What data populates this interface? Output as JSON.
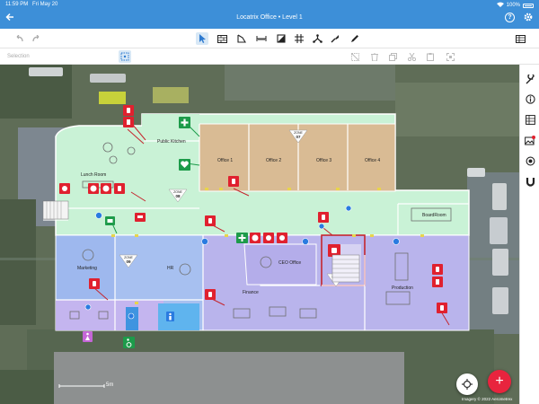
{
  "status_bar": {
    "time": "11:59 PM",
    "date": "Fri May 20",
    "battery": "100%"
  },
  "header": {
    "title": "Locatrix Office • Level 1",
    "back_icon": "back-arrow-icon",
    "help_label": "?",
    "settings_icon": "gear-icon"
  },
  "toolbar": {
    "undo_icon": "undo-icon",
    "redo_icon": "redo-icon",
    "tools": [
      "select-arrow-icon",
      "wall-icon",
      "room-icon",
      "dimension-icon",
      "door-icon",
      "grid-icon",
      "network-icon",
      "marker-icon",
      "pen-icon"
    ],
    "table_icon": "table-icon"
  },
  "subbar": {
    "label": "Selection",
    "actions": [
      "select-area-icon",
      "deselect-icon",
      "delete-icon",
      "copy-icon",
      "cut-icon",
      "paste-icon",
      "fit-icon"
    ]
  },
  "rooms": {
    "public_kitchen": "Public Kitchen",
    "office_1": "Office 1",
    "office_2": "Office 2",
    "office_3": "Office 3",
    "office_4": "Office 4",
    "lunch_room": "Lunch Room",
    "boardroom": "BoardRoom",
    "marketing": "Marketing",
    "hr": "HR",
    "ceo_office": "CEO Office",
    "finance": "Finance",
    "production": "Production"
  },
  "zones": [
    {
      "label": "ZONE",
      "number": "07"
    },
    {
      "label": "ZONE",
      "number": "08"
    },
    {
      "label": "ZONE",
      "number": "09"
    },
    {
      "label": "ZONE",
      "number": "10"
    }
  ],
  "right_panel": [
    "wrench-icon",
    "info-icon",
    "list-icon",
    "image-icon",
    "target-icon",
    "magnet-icon"
  ],
  "map_footer": {
    "scale": "5m",
    "copyright": "Imagery © 2022 Aerometrex"
  },
  "fabs": {
    "locate_icon": "crosshair-icon",
    "add_label": "+"
  },
  "colors": {
    "header_blue": "#3d8fd8",
    "zone_green": "#c9f2d6",
    "zone_purple": "#b9b4ec",
    "zone_blue": "#9eb8ee",
    "office_tan": "#d9bb94",
    "fire_red": "#e0212f",
    "exit_green": "#1d9b4a",
    "add_button": "#e8243e"
  }
}
